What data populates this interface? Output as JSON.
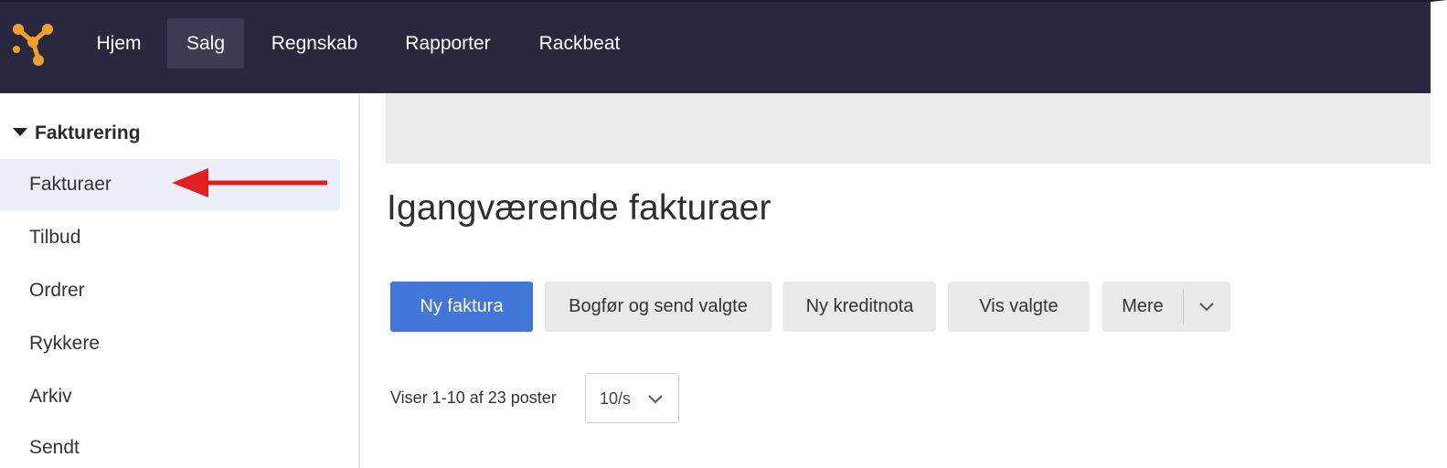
{
  "header": {
    "nav": [
      {
        "label": "Hjem"
      },
      {
        "label": "Salg"
      },
      {
        "label": "Regnskab"
      },
      {
        "label": "Rapporter"
      },
      {
        "label": "Rackbeat"
      }
    ],
    "active": "Salg",
    "brand_color": "#f0a030"
  },
  "sidebar": {
    "section": "Fakturering",
    "items": [
      {
        "label": "Fakturaer"
      },
      {
        "label": "Tilbud"
      },
      {
        "label": "Ordrer"
      },
      {
        "label": "Rykkere"
      },
      {
        "label": "Arkiv"
      },
      {
        "label": "Sendt"
      }
    ],
    "active": "Fakturaer",
    "annotation_arrow_color": "#e02020"
  },
  "main": {
    "title": "Igangværende fakturaer",
    "buttons": {
      "new_invoice": "Ny faktura",
      "post_send": "Bogfør og send valgte",
      "credit_note": "Ny kreditnota",
      "show_selected": "Vis valgte",
      "more": "Mere"
    },
    "primary_color": "#4276d8",
    "paging": {
      "summary": "Viser 1-10 af 23 poster",
      "per_page": "10/s"
    }
  }
}
